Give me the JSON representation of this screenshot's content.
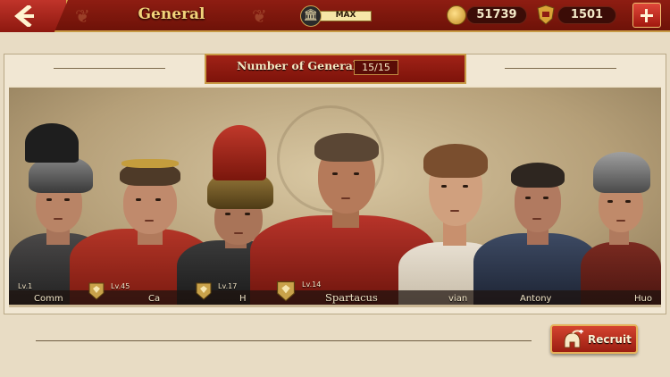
{
  "header": {
    "title": "General",
    "vip_label": "MAX",
    "coins": "51739",
    "honor": "1501"
  },
  "panel": {
    "title": "Number of Generals",
    "count": "15/15"
  },
  "generals": [
    {
      "name": "Comm",
      "level": "Lv.1"
    },
    {
      "name": "Ca",
      "level": "Lv.45"
    },
    {
      "name": "H",
      "level": "Lv.17"
    },
    {
      "name": "Spartacus",
      "level": "Lv.14"
    },
    {
      "name": "vian",
      "level": ""
    },
    {
      "name": "Antony",
      "level": ""
    },
    {
      "name": "Huo",
      "level": ""
    }
  ],
  "actions": {
    "recruit_label": "Recruit"
  },
  "colors": {
    "topbar": "#7d160b",
    "accent_gold": "#c89a45",
    "panel_bg": "#f1e7d3"
  },
  "icons": [
    "back-arrow-icon",
    "vip-temple-icon",
    "coin-icon",
    "honor-crest-icon",
    "plus-icon",
    "rank-badge-icon",
    "spartan-helmet-icon"
  ]
}
